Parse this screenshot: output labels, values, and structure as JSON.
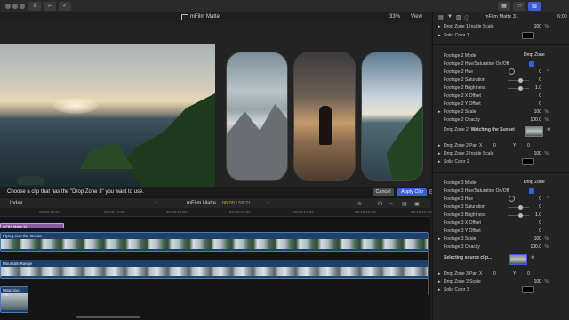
{
  "app": {
    "toolbar": {
      "left_icons": [
        "import-icon",
        "keyword-icon",
        "check-icon"
      ],
      "right_icons": [
        "browser-layout-icon",
        "timeline-layout-icon",
        "inspector-layout-icon"
      ]
    }
  },
  "viewer": {
    "title": "mFilm Matte",
    "zoom": "33%",
    "view_menu": "View"
  },
  "prompt": {
    "text": "Choose a clip that has the \"Drop Zone 3\" you want to use.",
    "cancel": "Cancel",
    "apply": "Apply Clip"
  },
  "timeline": {
    "index": "Index",
    "project": "mFilm Matte",
    "timecode": "06:00",
    "duration": "/ 58:21",
    "ruler": [
      "00:00:13:00",
      "00:00:14:00",
      "00:00:15:00",
      "00:00:16:00",
      "00:00:17:00",
      "00:00:18:00",
      "00:00:19:00"
    ],
    "title_clip": "mFilm Matte 31",
    "clips": [
      {
        "label": "Flying over the Ocean"
      },
      {
        "label": "Mountain Range"
      },
      {
        "label": "Watching the..."
      }
    ]
  },
  "inspector": {
    "title": "mFilm Matte 31",
    "time": "6:00",
    "rows": {
      "dz1_scale": {
        "label": "Drop Zone 1 Inside Scale",
        "value": "100",
        "unit": "%"
      },
      "solid1": {
        "label": "Solid Color 1"
      },
      "f2_mode": {
        "label": "Footage 2 Mode",
        "value": "Drop Zone"
      },
      "f2_hue_sat": {
        "label": "Footage 2 Hue/Saturation On/Off"
      },
      "f2_hue": {
        "label": "Footage 2 Hue",
        "value": "0",
        "unit": "°"
      },
      "f2_sat": {
        "label": "Footage 2 Saturation",
        "value": "0"
      },
      "f2_bright": {
        "label": "Footage 2 Brightness",
        "value": "1.0"
      },
      "f2_x": {
        "label": "Footage 2 X Offset",
        "value": "0"
      },
      "f2_y": {
        "label": "Footage 2 Y Offset",
        "value": "0"
      },
      "f2_scale": {
        "label": "Footage 2 Scale",
        "value": "100",
        "unit": "%"
      },
      "f2_opacity": {
        "label": "Footage 2 Opacity",
        "value": "100.0",
        "unit": "%"
      },
      "dz2": {
        "label": "Drop Zone 2:",
        "clip": "Watching the Sunset"
      },
      "dz2_pan": {
        "label": "Drop Zone 2 Pan",
        "x_label": "X",
        "x": "0",
        "y_label": "Y",
        "y": "0"
      },
      "dz2_scale": {
        "label": "Drop Zone 2 Inside Scale",
        "value": "100",
        "unit": "%"
      },
      "solid2": {
        "label": "Solid Color 2"
      },
      "f3_mode": {
        "label": "Footage 3 Mode",
        "value": "Drop Zone"
      },
      "f3_hue_sat": {
        "label": "Footage 3 Hue/Saturation On/Off"
      },
      "f3_hue": {
        "label": "Footage 3 Hue",
        "value": "0",
        "unit": "°"
      },
      "f3_sat": {
        "label": "Footage 3 Saturation",
        "value": "0"
      },
      "f3_bright": {
        "label": "Footage 3 Brightness",
        "value": "1.0"
      },
      "f3_x": {
        "label": "Footage 3 X Offset",
        "value": "0"
      },
      "f3_y": {
        "label": "Footage 3 Y Offset",
        "value": "0"
      },
      "f3_scale": {
        "label": "Footage 3 Scale",
        "value": "100",
        "unit": "%"
      },
      "f3_opacity": {
        "label": "Footage 3 Opacity",
        "value": "100.0",
        "unit": "%"
      },
      "dz3": {
        "label": "Selecting source clip..."
      },
      "dz3_pan": {
        "label": "Drop Zone 3 Pan",
        "x_label": "X",
        "x": "0",
        "y_label": "Y",
        "y": "0"
      },
      "dz3_scale": {
        "label": "Drop Zone 3 Scale",
        "value": "100",
        "unit": "%"
      },
      "solid3": {
        "label": "Solid Color 3"
      }
    }
  },
  "colors": {
    "accent": "#3d5fd6",
    "clip": "#20406a",
    "title_clip": "#8a5aa8",
    "timecode": "#d8a74a"
  }
}
